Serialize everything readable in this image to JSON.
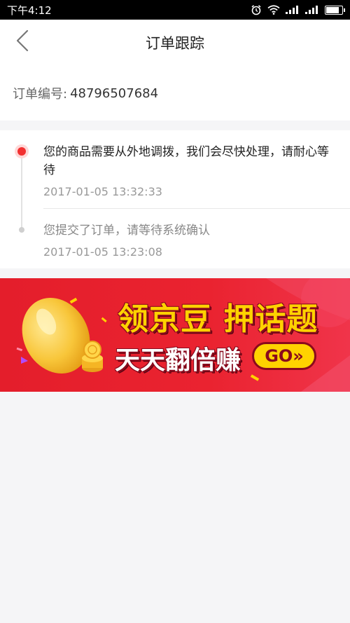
{
  "status_bar": {
    "time": "下午4:12",
    "icons": [
      "alarm-icon",
      "wifi-icon",
      "signal-icon",
      "signal-icon",
      "battery-icon"
    ]
  },
  "nav": {
    "back_icon": "chevron-left-icon",
    "title": "订单跟踪"
  },
  "order": {
    "label": "订单编号:",
    "number": "48796507684"
  },
  "tracking": {
    "events": [
      {
        "text": "您的商品需要从外地调拨，我们会尽快处理，请耐心等待",
        "time": "2017-01-05 13:32:33",
        "status": "current"
      },
      {
        "text": "您提交了订单，请等待系统确认",
        "time": "2017-01-05 13:23:08",
        "status": "past"
      }
    ]
  },
  "promo": {
    "line1": "领京豆 押话题",
    "line2": "天天翻倍赚",
    "go_label": "GO»",
    "colors": {
      "background": "#e8202e",
      "headline": "#ffd200",
      "outline": "#8a0a1d"
    }
  },
  "colors": {
    "accent": "#f23030",
    "page_background": "#f5f5f7"
  }
}
